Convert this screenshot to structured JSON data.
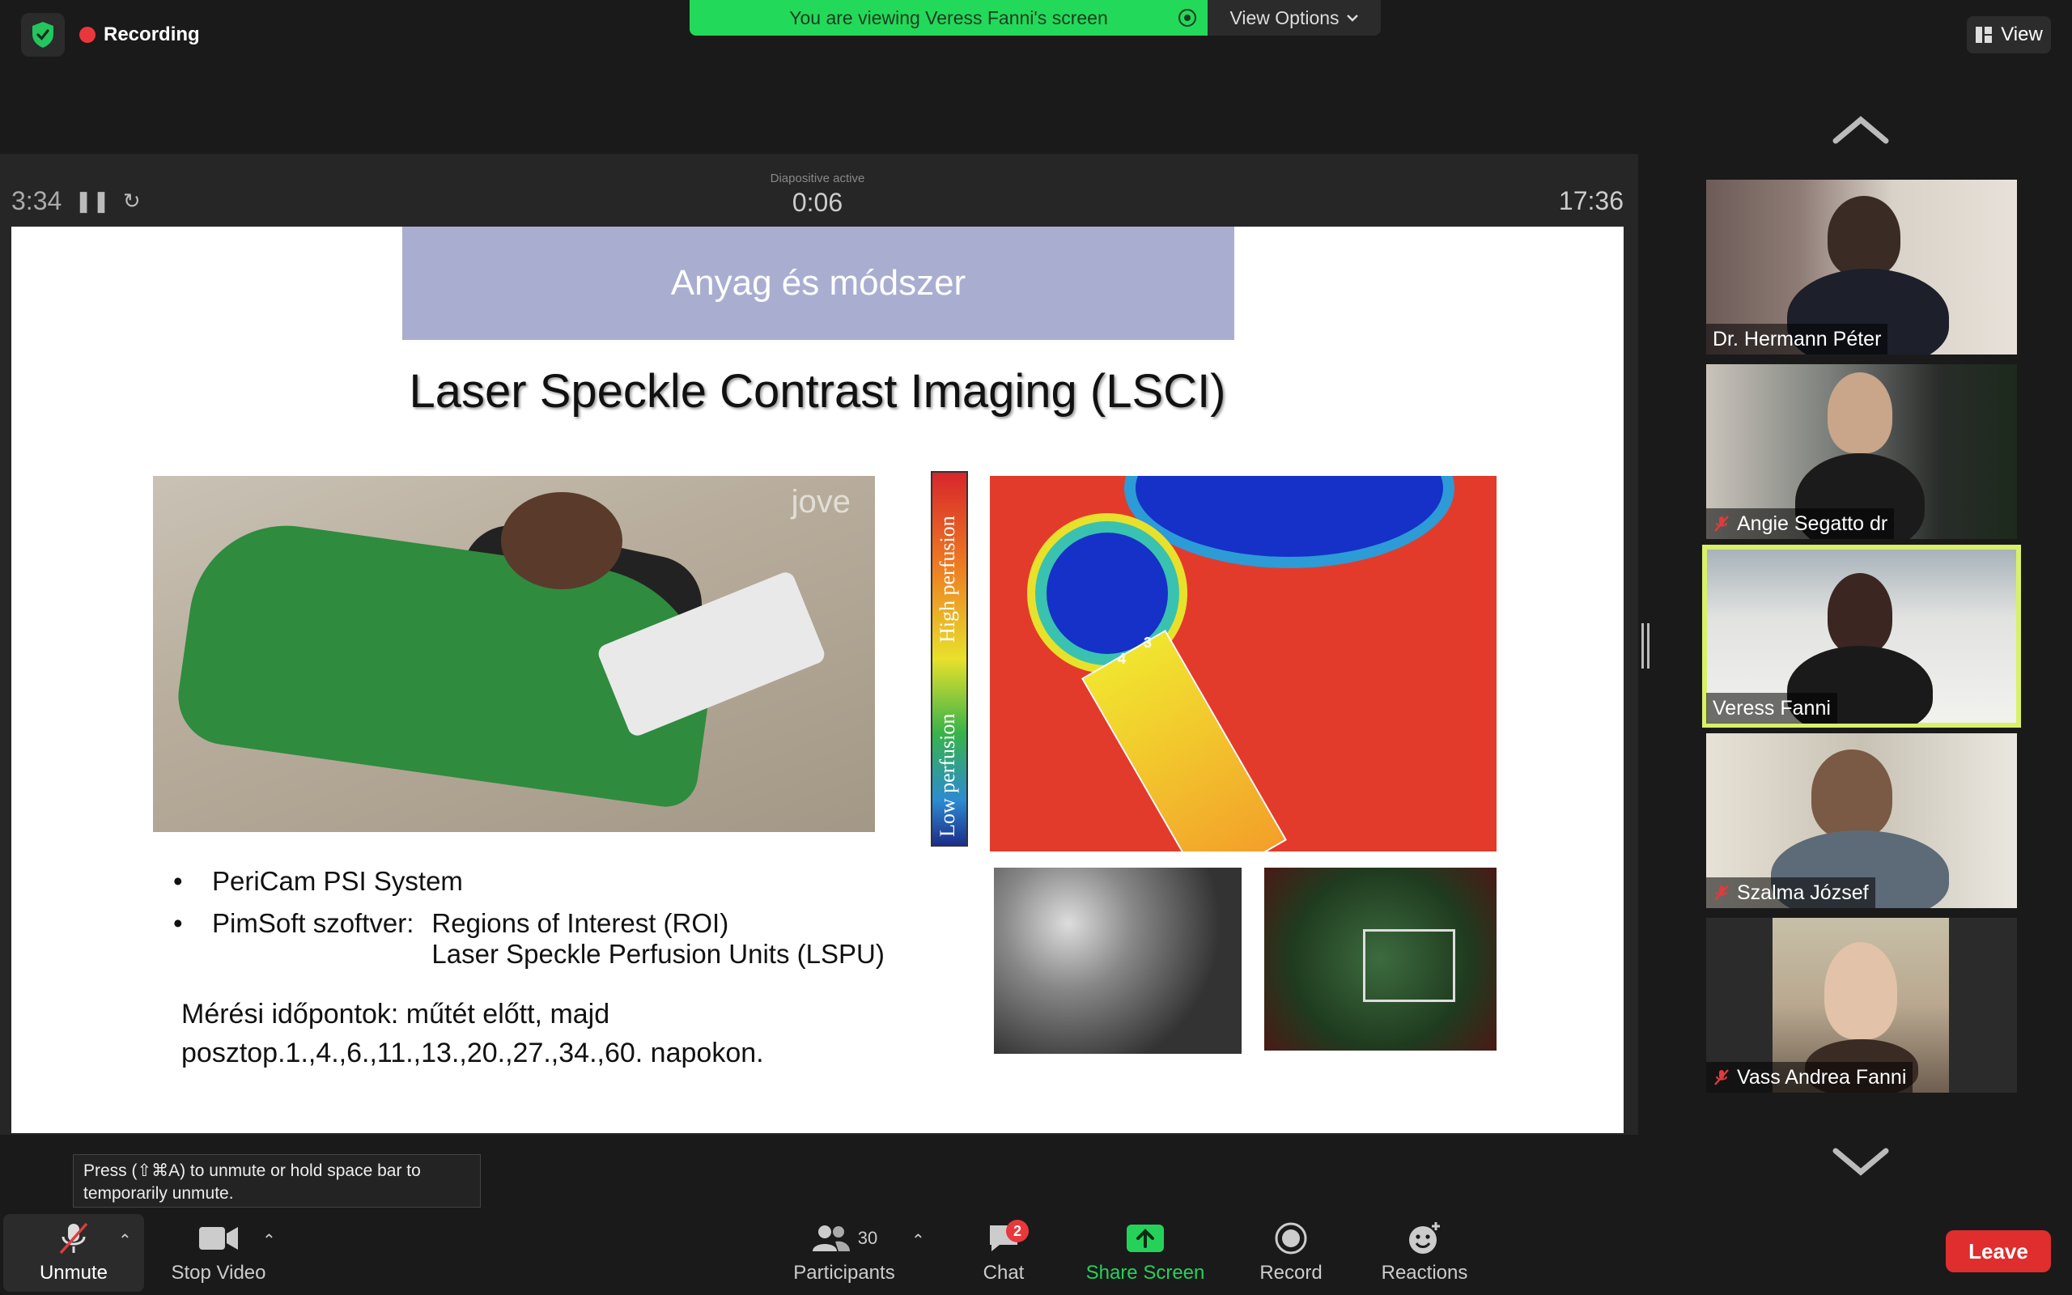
{
  "top": {
    "recording_label": "Recording",
    "viewing_banner": "You are viewing Veress Fanni's screen",
    "view_options_label": "View Options",
    "view_label": "View"
  },
  "presentation": {
    "elapsed": "3:34",
    "status_label": "Diapositive active",
    "slide_time": "0:06",
    "clock": "17:36"
  },
  "slide": {
    "header": "Anyag és módszer",
    "title": "Laser Speckle Contrast Imaging (LSCI)",
    "photo_watermark": "jove",
    "scale_high": "High perfusion",
    "scale_low": "Low perfusion",
    "perf_num_3": "3",
    "perf_num_4": "4",
    "bullets": [
      {
        "label": "PeriCam PSI System"
      },
      {
        "label": "PimSoft szoftver:",
        "sub1": "Regions of Interest (ROI)",
        "sub2": "Laser Speckle Perfusion Units (LSPU)"
      }
    ],
    "bullet_char": "•",
    "measure_line1": "Mérési időpontok: műtét előtt, majd",
    "measure_line2": "posztop.1.,4.,6.,11.,13.,20.,27.,34.,60. napokon."
  },
  "participants_panel": [
    {
      "name": "Dr. Hermann Péter",
      "muted": false,
      "active": false
    },
    {
      "name": "Angie Segatto dr",
      "muted": true,
      "active": false
    },
    {
      "name": "Veress Fanni",
      "muted": false,
      "active": true
    },
    {
      "name": "Szalma József",
      "muted": true,
      "active": false
    },
    {
      "name": "Vass Andrea Fanni",
      "muted": true,
      "active": false
    }
  ],
  "tooltip": {
    "line1": "Press  (⇧⌘A) to unmute or hold space bar to",
    "line2": "temporarily unmute."
  },
  "toolbar": {
    "unmute_label": "Unmute",
    "stop_video_label": "Stop Video",
    "participants_label": "Participants",
    "participants_count": "30",
    "chat_label": "Chat",
    "chat_badge": "2",
    "share_screen_label": "Share Screen",
    "record_label": "Record",
    "reactions_label": "Reactions",
    "leave_label": "Leave"
  },
  "colors": {
    "accent_green": "#23d959",
    "active_speaker": "#d9f06a",
    "leave_red": "#e02d2d",
    "slide_header_bg": "#a9aed1"
  }
}
